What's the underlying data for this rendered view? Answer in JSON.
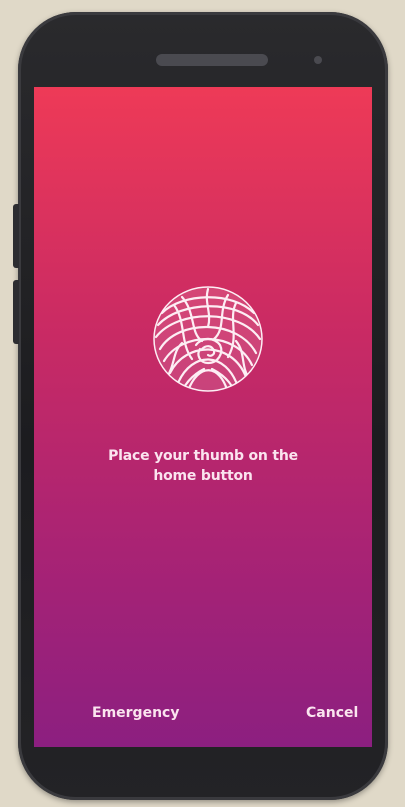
{
  "auth": {
    "prompt_line_1": "Place your thumb on the",
    "prompt_line_2": "home button",
    "fingerprint_icon": "fingerprint-icon"
  },
  "footer": {
    "emergency_label": "Emergency",
    "cancel_label": "Cancel"
  },
  "colors": {
    "background": "#e0d9c8",
    "phone_body": "#1f1f22",
    "gradient_top": "#ee3a57",
    "gradient_bottom": "#8c1f80",
    "text": "#fbe4ef"
  }
}
